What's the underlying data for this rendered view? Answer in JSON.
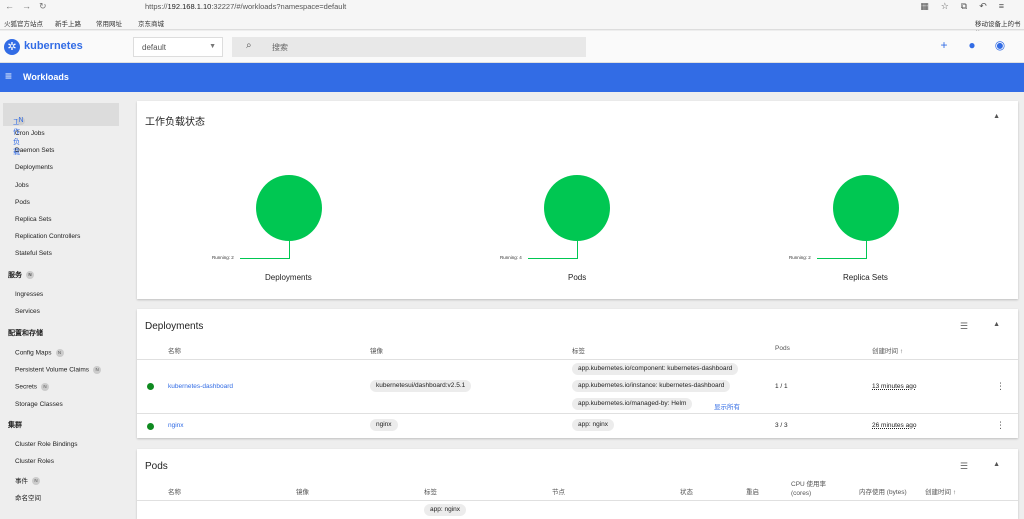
{
  "browser": {
    "url_prefix": "https://",
    "url_host": "192.168.1.10",
    "url_rest": ":32227/#/workloads?namespace=default",
    "bookmarks": [
      "火狐官方站点",
      "新手上路",
      "常用网址",
      "京东商城"
    ],
    "mobile_bookmarks": "移动设备上的书签"
  },
  "header": {
    "brand": "kubernetes",
    "namespace": "default",
    "search_placeholder": "搜索"
  },
  "toolbar": {
    "title": "Workloads"
  },
  "sidebar": {
    "workloads_label": "工作负载",
    "workloads_badge": "N",
    "workload_items": [
      "Cron Jobs",
      "Daemon Sets",
      "Deployments",
      "Jobs",
      "Pods",
      "Replica Sets",
      "Replication Controllers",
      "Stateful Sets"
    ],
    "service_label": "服务",
    "service_badge": "N",
    "service_items": [
      "Ingresses",
      "Services"
    ],
    "config_label": "配置和存储",
    "config_items": [
      {
        "label": "Config Maps",
        "badge": "N"
      },
      {
        "label": "Persistent Volume Claims",
        "badge": "N"
      },
      {
        "label": "Secrets",
        "badge": "N"
      },
      {
        "label": "Storage Classes",
        "badge": ""
      }
    ],
    "cluster_label": "集群",
    "cluster_items": [
      {
        "label": "Cluster Role Bindings",
        "badge": ""
      },
      {
        "label": "Cluster Roles",
        "badge": ""
      },
      {
        "label": "事件",
        "badge": "N"
      },
      {
        "label": "命名空间",
        "badge": ""
      }
    ]
  },
  "status_card": {
    "title": "工作负载状态",
    "charts": [
      {
        "name": "Deployments",
        "running_label": "Running: 2",
        "running": 2
      },
      {
        "name": "Pods",
        "running_label": "Running: 4",
        "running": 4
      },
      {
        "name": "Replica Sets",
        "running_label": "Running: 2",
        "running": 2
      }
    ],
    "status_color": "#00c752"
  },
  "deployments_card": {
    "title": "Deployments",
    "headers": {
      "name": "名称",
      "image": "镜像",
      "labels": "标签",
      "pods": "Pods",
      "created": "创建时间"
    },
    "rows": [
      {
        "name": "kubernetes-dashboard",
        "image": "kubernetesui/dashboard:v2.5.1",
        "labels": [
          "app.kubernetes.io/component: kubernetes-dashboard",
          "app.kubernetes.io/instance: kubernetes-dashboard",
          "app.kubernetes.io/managed-by: Helm"
        ],
        "show_all": "显示所有",
        "pods": "1 / 1",
        "created": "13 minutes ago"
      },
      {
        "name": "nginx",
        "image": "nginx",
        "labels": [
          "app: nginx"
        ],
        "pods": "3 / 3",
        "created": "26 minutes ago"
      }
    ]
  },
  "pods_card": {
    "title": "Pods",
    "headers": {
      "name": "名称",
      "image": "镜像",
      "labels": "标签",
      "node": "节点",
      "status": "状态",
      "restarts": "重启",
      "cpu": "CPU 使用率",
      "cpu_unit": "(cores)",
      "memory": "内存使用 (bytes)",
      "created": "创建时间"
    },
    "partial_label": "app: nginx"
  }
}
